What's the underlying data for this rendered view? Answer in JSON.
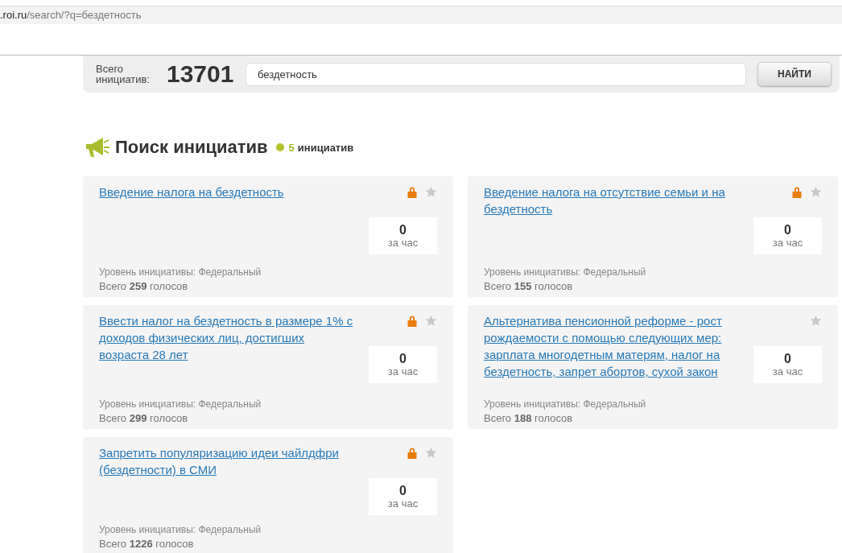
{
  "address_bar": {
    "host": ".roi.ru",
    "path": "/search/?q=бездетность"
  },
  "search_panel": {
    "total_label": "Всего инициатив:",
    "total": "13701",
    "query": "бездетность",
    "button": "НАЙТИ"
  },
  "heading": {
    "title": "Поиск инициатив",
    "count": "5",
    "count_label": "инициатив"
  },
  "initiatives": [
    {
      "title": "Введение налога на бездетность",
      "locked": true,
      "starred": false,
      "votes_hour": "0",
      "period": "за час",
      "level": "Уровень инициативы: Федеральный",
      "total": "Всего **259** голосов"
    },
    {
      "title": "Введение налога на отсутствие семьи и на бездетность",
      "locked": true,
      "starred": false,
      "votes_hour": "0",
      "period": "за час",
      "level": "Уровень инициативы: Федеральный",
      "total": "Всего **155** голосов"
    },
    {
      "title": "Ввести налог на бездетность в размере 1% с доходов физических лиц, достигших возраста 28 лет",
      "locked": true,
      "starred": false,
      "votes_hour": "0",
      "period": "за час",
      "level": "Уровень инициативы: Федеральный",
      "total": "Всего **299** голосов"
    },
    {
      "title": "Альтернатива пенсионной реформе - рост рождаемости с помощью следующих мер: зарплата многодетным матерям, налог на бездетность, запрет абортов, сухой закон",
      "locked": false,
      "starred": false,
      "votes_hour": "0",
      "period": "за час",
      "level": "Уровень инициативы: Федеральный",
      "total": "Всего **188** голосов"
    },
    {
      "title": "Запретить популяризацию идеи чайлдфри (бездетности) в СМИ",
      "locked": true,
      "starred": false,
      "votes_hour": "0",
      "period": "за час",
      "level": "Уровень инициативы: Федеральный",
      "total": "Всего **1226** голосов"
    }
  ]
}
